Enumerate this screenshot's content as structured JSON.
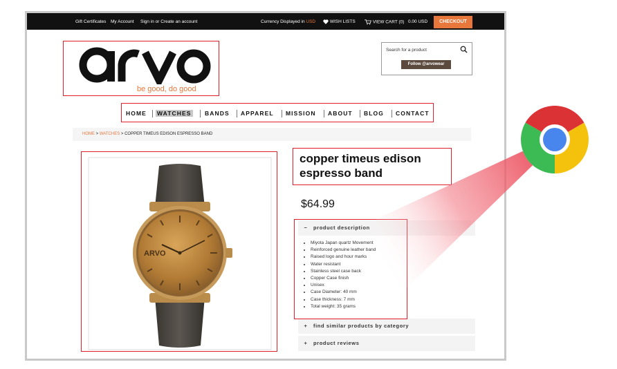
{
  "topbar": {
    "gift_certificates": "Gift Certificates",
    "my_account": "My Account",
    "sign_in": "Sign in or Create an account",
    "currency_prefix": "Currency Displayed in",
    "currency_code": "USD",
    "wish_lists": "WISH LISTS",
    "view_cart": "VIEW CART (0)",
    "cart_total": "0.00 USD",
    "checkout": "CHECKOUT"
  },
  "logo": {
    "wordmark": "arvo",
    "tagline": "be good, do good"
  },
  "search": {
    "placeholder": "Search for a product",
    "follow_label": "Follow @arvowear"
  },
  "nav": {
    "items": [
      "HOME",
      "WATCHES",
      "BANDS",
      "APPAREL",
      "MISSION",
      "ABOUT",
      "BLOG",
      "CONTACT"
    ],
    "active": "WATCHES"
  },
  "breadcrumb": {
    "home": "HOME",
    "watches": "WATCHES",
    "current": "COPPER TIMEUS EDISON ESPRESSO BAND",
    "separator": ">"
  },
  "product": {
    "title_line1": "copper timeus edison",
    "title_line2": "espresso band",
    "price": "$64.99",
    "watch_brand": "ARVO"
  },
  "accordion": {
    "description_label": "product description",
    "description_symbol": "−",
    "features": [
      "Miyota Japan quartz Movement",
      "Reinforced genuine leather band",
      "Raised logo and hour marks",
      "Water resistant",
      "Stainless steel case back",
      "Copper Case finish",
      "Unisex",
      "Case Diameter: 40 mm",
      "Case thickness: 7 mm",
      "Total weight: 35 grams"
    ],
    "similar_label": "find similar products by category",
    "reviews_label": "product reviews",
    "expand_symbol": "+"
  },
  "colors": {
    "accent": "#e8773b",
    "highlight": "#e01e2a",
    "topbar": "#111111"
  }
}
